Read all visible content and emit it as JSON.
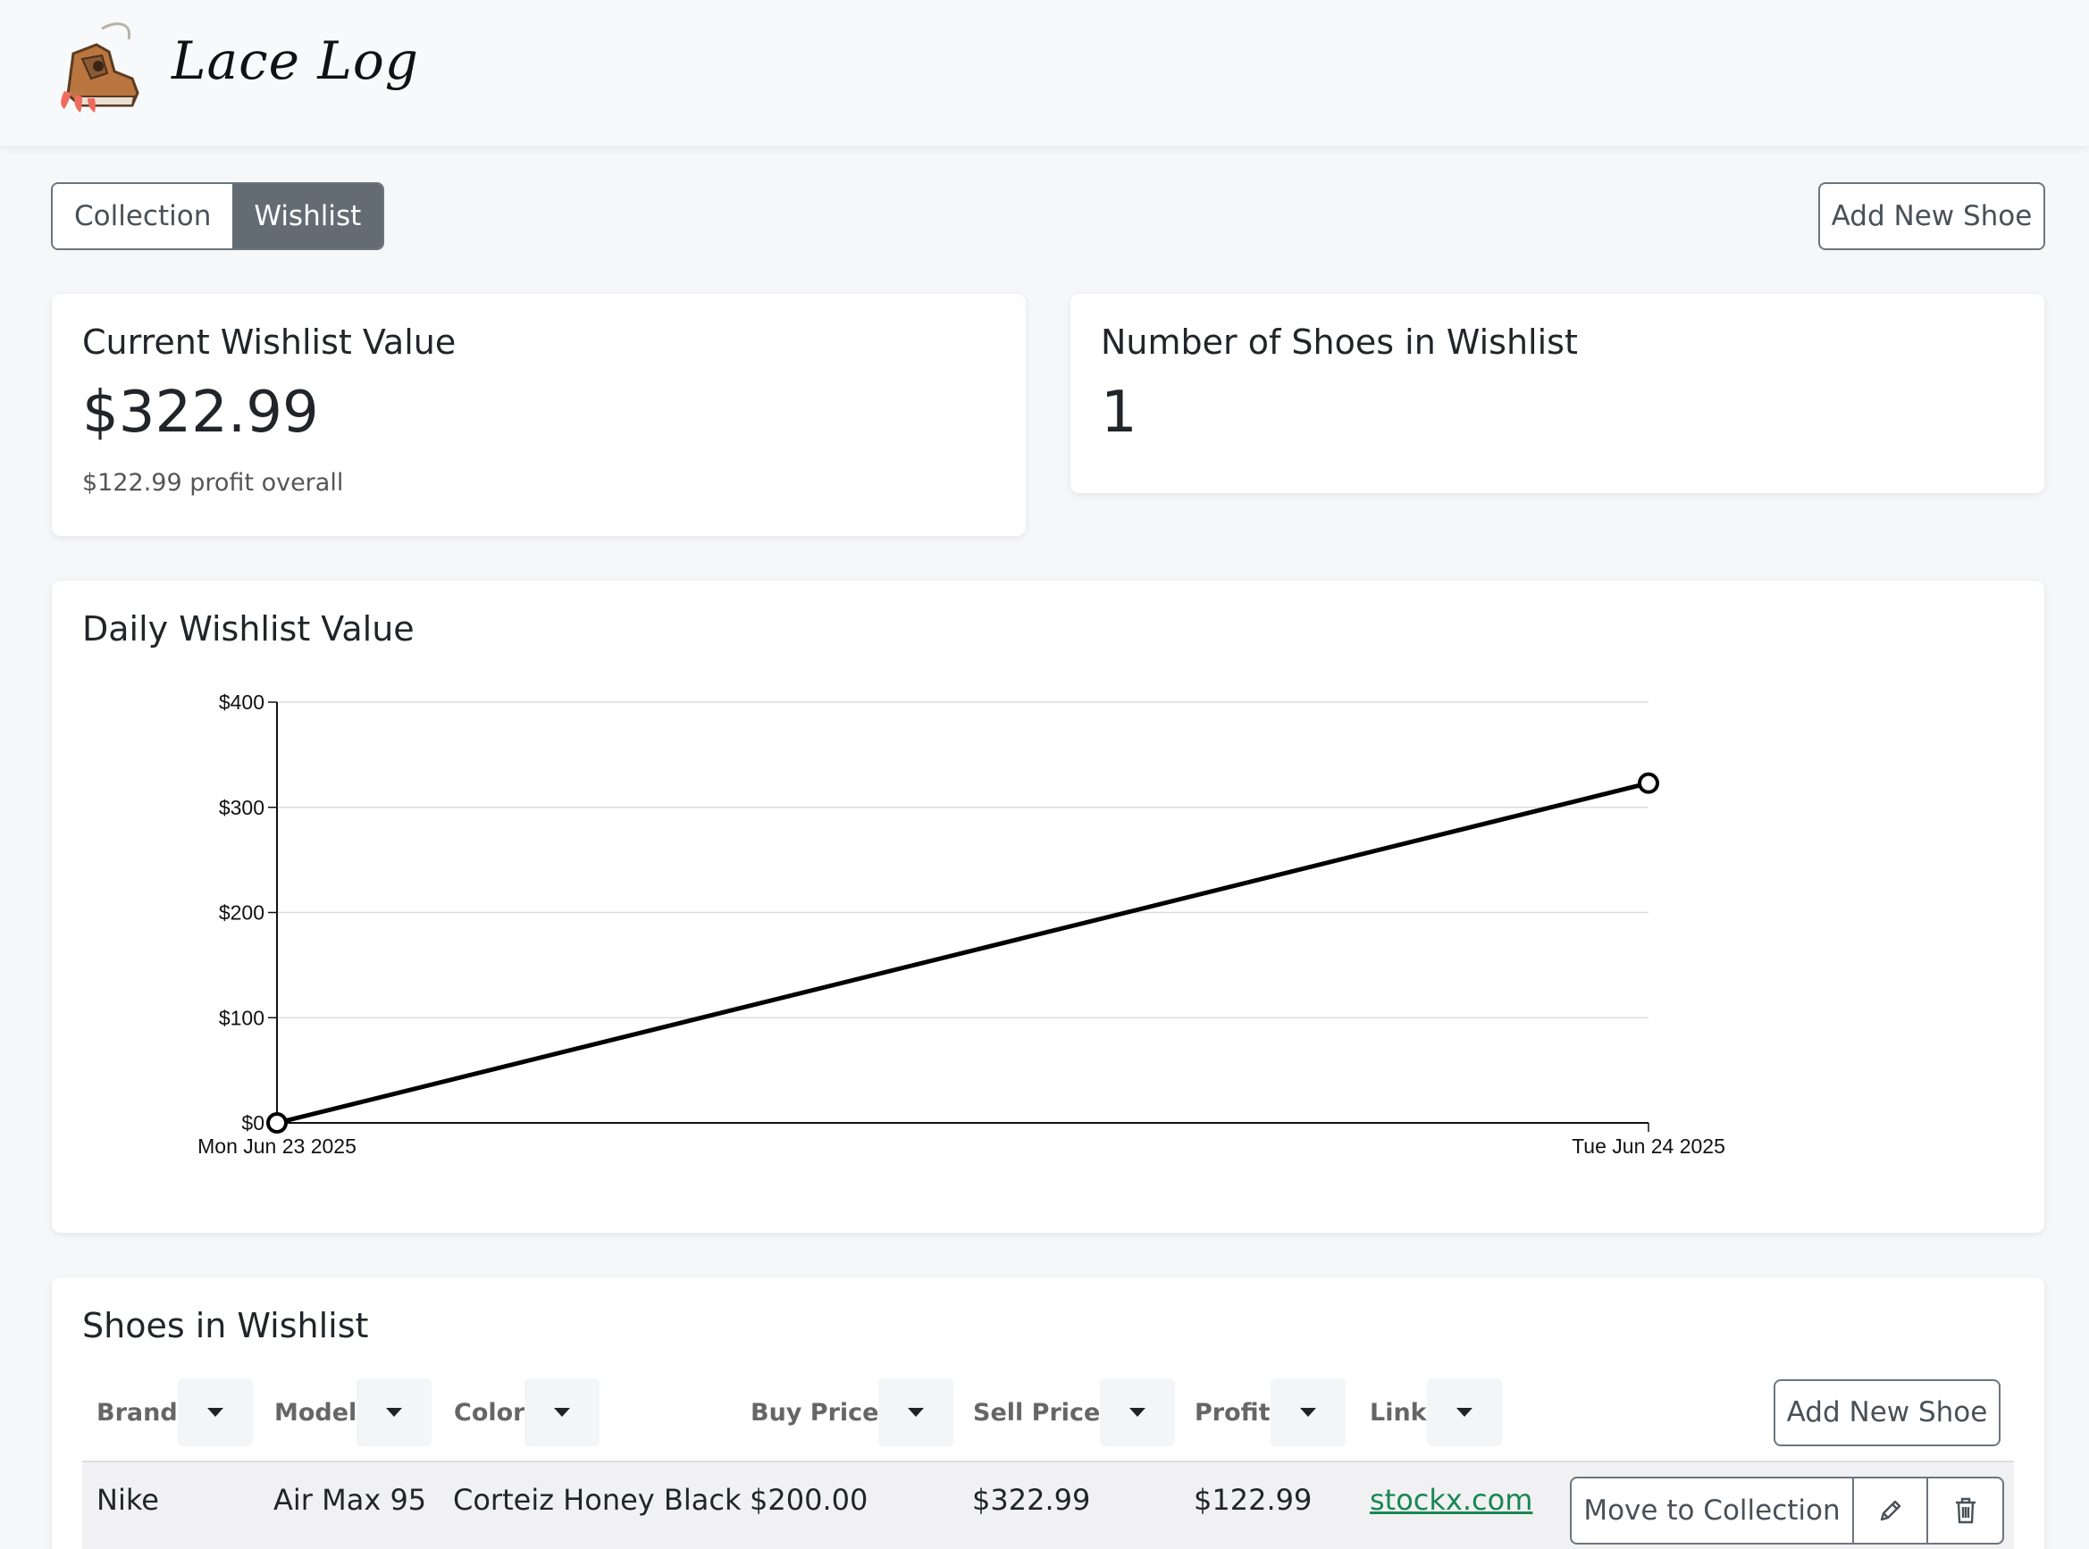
{
  "app": {
    "title": "Lace Log"
  },
  "tabs": [
    {
      "label": "Collection",
      "active": false
    },
    {
      "label": "Wishlist",
      "active": true
    }
  ],
  "header_button": "Add New Shoe",
  "stats": {
    "value_title": "Current Wishlist Value",
    "value": "$322.99",
    "profit_note": "$122.99 profit overall",
    "count_title": "Number of Shoes in Wishlist",
    "count": "1"
  },
  "chart_card": {
    "title": "Daily Wishlist Value"
  },
  "chart_data": {
    "type": "line",
    "title": "Daily Wishlist Value",
    "x": [
      "Mon Jun 23 2025",
      "Tue Jun 24 2025"
    ],
    "series": [
      {
        "values": [
          0,
          322.99
        ]
      }
    ],
    "yticks": [
      "$0",
      "$100",
      "$200",
      "$300",
      "$400"
    ],
    "ylim": [
      0,
      400
    ],
    "grid": true,
    "line_color": "#000000"
  },
  "table": {
    "title": "Shoes in Wishlist",
    "columns": [
      "Brand",
      "Model",
      "Color",
      "Buy Price",
      "Sell Price",
      "Profit",
      "Link"
    ],
    "add_button": "Add New Shoe",
    "rows": [
      {
        "brand": "Nike",
        "model": "Air Max 95",
        "color": "Corteiz Honey Black",
        "buy_price": "$200.00",
        "sell_price": "$322.99",
        "profit": "$122.99",
        "link": "stockx.com"
      }
    ],
    "row_actions": {
      "move": "Move to Collection",
      "edit_icon": "pencil-icon",
      "delete_icon": "trash-icon"
    }
  },
  "colors": {
    "accent_tab": "#646c73",
    "link": "#198754",
    "background": "#f6f7f9"
  }
}
